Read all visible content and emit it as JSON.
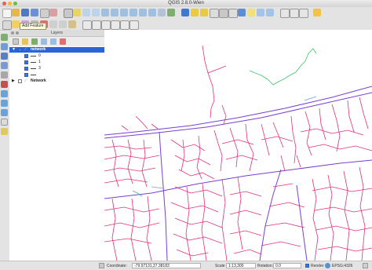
{
  "window": {
    "title": "QGIS 2.8.0-Wien"
  },
  "tooltip": {
    "text": "Add Feature"
  },
  "layers_panel": {
    "title": "Layers",
    "layers": [
      {
        "name": "network",
        "checked": true,
        "selected": true,
        "expanded": true,
        "categories": [
          {
            "label": "0"
          },
          {
            "label": "1"
          },
          {
            "label": "3"
          },
          {
            "label": ""
          }
        ]
      },
      {
        "name": "Network",
        "checked": false,
        "selected": false,
        "expanded": false,
        "categories": []
      }
    ]
  },
  "map": {
    "background": "#ffffff",
    "road_color": "#e0307a",
    "main_road_color": "#7a3fd0",
    "minor_color": "#3ec46a"
  },
  "statusbar": {
    "coordinate_label": "Coordinate:",
    "coordinate_value": "-79.97131,37.38183",
    "scale_label": "Scale",
    "scale_value": "1:13,300",
    "rotation_label": "Rotation:",
    "rotation_value": "0.0",
    "render_label": "Render",
    "crs_label": "EPSG:4326"
  }
}
